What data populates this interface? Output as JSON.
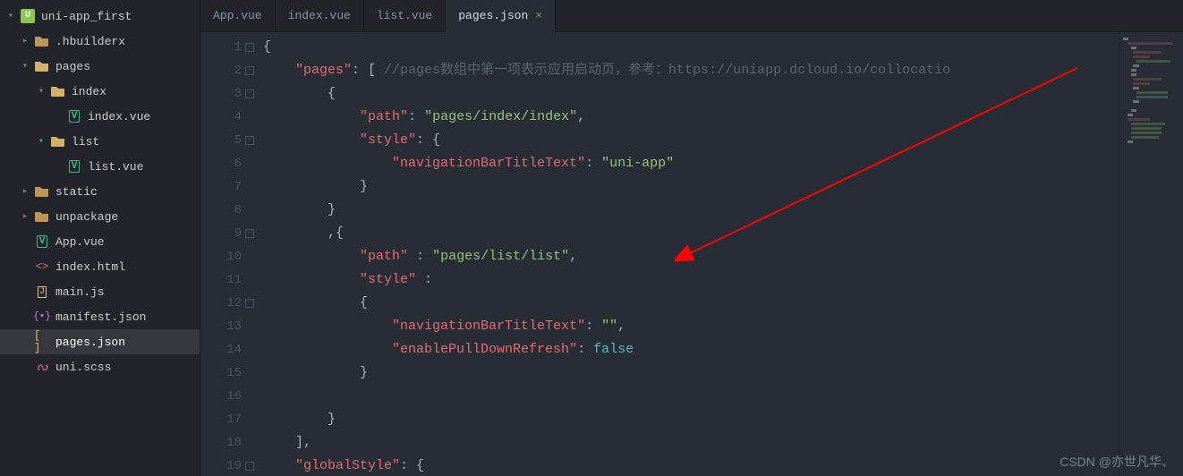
{
  "project": "uni-app_first",
  "tree": [
    {
      "name": ".hbuilderx",
      "type": "folder",
      "state": "closed",
      "indent": 1
    },
    {
      "name": "pages",
      "type": "folder",
      "state": "open",
      "indent": 1
    },
    {
      "name": "index",
      "type": "folder",
      "state": "open",
      "indent": 2
    },
    {
      "name": "index.vue",
      "type": "vue",
      "indent": 3
    },
    {
      "name": "list",
      "type": "folder",
      "state": "open",
      "indent": 2
    },
    {
      "name": "list.vue",
      "type": "vue",
      "indent": 3
    },
    {
      "name": "static",
      "type": "folder",
      "state": "closed",
      "indent": 1
    },
    {
      "name": "unpackage",
      "type": "folder",
      "state": "closed",
      "indent": 1
    },
    {
      "name": "App.vue",
      "type": "vue",
      "indent": 1
    },
    {
      "name": "index.html",
      "type": "html",
      "indent": 1
    },
    {
      "name": "main.js",
      "type": "js",
      "indent": 1
    },
    {
      "name": "manifest.json",
      "type": "json-m",
      "indent": 1
    },
    {
      "name": "pages.json",
      "type": "json-b",
      "indent": 1,
      "selected": true
    },
    {
      "name": "uni.scss",
      "type": "scss",
      "indent": 1
    }
  ],
  "tabs": [
    {
      "label": "App.vue",
      "active": false
    },
    {
      "label": "index.vue",
      "active": false
    },
    {
      "label": "list.vue",
      "active": false
    },
    {
      "label": "pages.json",
      "active": true
    }
  ],
  "code": {
    "lines": [
      {
        "n": 1,
        "fold": true,
        "raw": "{",
        "segs": [
          [
            "{",
            "punct"
          ]
        ]
      },
      {
        "n": 2,
        "fold": true,
        "segs": [
          [
            "    ",
            "p"
          ],
          [
            "\"pages\"",
            "key"
          ],
          [
            ": [ ",
            "punct"
          ],
          [
            "//pages数组中第一项表示应用启动页，参考：https://uniapp.dcloud.io/collocatio",
            "comment"
          ]
        ]
      },
      {
        "n": 3,
        "fold": true,
        "segs": [
          [
            "        {",
            "punct"
          ]
        ]
      },
      {
        "n": 4,
        "segs": [
          [
            "            ",
            "p"
          ],
          [
            "\"path\"",
            "key"
          ],
          [
            ": ",
            "punct"
          ],
          [
            "\"pages/index/index\"",
            "string"
          ],
          [
            ",",
            "punct"
          ]
        ]
      },
      {
        "n": 5,
        "fold": true,
        "segs": [
          [
            "            ",
            "p"
          ],
          [
            "\"style\"",
            "key"
          ],
          [
            ": {",
            "punct"
          ]
        ]
      },
      {
        "n": 6,
        "segs": [
          [
            "                ",
            "p"
          ],
          [
            "\"navigationBarTitleText\"",
            "key"
          ],
          [
            ": ",
            "punct"
          ],
          [
            "\"uni-app\"",
            "string"
          ]
        ]
      },
      {
        "n": 7,
        "segs": [
          [
            "            }",
            "punct"
          ]
        ]
      },
      {
        "n": 8,
        "segs": [
          [
            "        }",
            "punct"
          ]
        ]
      },
      {
        "n": 9,
        "fold": true,
        "segs": [
          [
            "        ,{",
            "punct"
          ]
        ]
      },
      {
        "n": 10,
        "segs": [
          [
            "            ",
            "p"
          ],
          [
            "\"path\"",
            "key"
          ],
          [
            " : ",
            "punct"
          ],
          [
            "\"pages/list/list\"",
            "string"
          ],
          [
            ",",
            "punct"
          ]
        ]
      },
      {
        "n": 11,
        "segs": [
          [
            "            ",
            "p"
          ],
          [
            "\"style\"",
            "key"
          ],
          [
            " :",
            "punct"
          ]
        ]
      },
      {
        "n": 12,
        "fold": true,
        "segs": [
          [
            "            {",
            "punct"
          ]
        ]
      },
      {
        "n": 13,
        "segs": [
          [
            "                ",
            "p"
          ],
          [
            "\"navigationBarTitleText\"",
            "key"
          ],
          [
            ": ",
            "punct"
          ],
          [
            "\"\"",
            "string"
          ],
          [
            ",",
            "punct"
          ]
        ]
      },
      {
        "n": 14,
        "segs": [
          [
            "                ",
            "p"
          ],
          [
            "\"enablePullDownRefresh\"",
            "key"
          ],
          [
            ": ",
            "punct"
          ],
          [
            "false",
            "bool"
          ]
        ]
      },
      {
        "n": 15,
        "segs": [
          [
            "            }",
            "punct"
          ]
        ]
      },
      {
        "n": 16,
        "segs": [
          [
            "",
            "p"
          ]
        ]
      },
      {
        "n": 17,
        "segs": [
          [
            "        }",
            "punct"
          ]
        ]
      },
      {
        "n": 18,
        "segs": [
          [
            "    ],",
            "punct"
          ]
        ]
      },
      {
        "n": 19,
        "fold": true,
        "segs": [
          [
            "    ",
            "p"
          ],
          [
            "\"globalStyle\"",
            "key"
          ],
          [
            ": {",
            "punct"
          ]
        ]
      }
    ]
  },
  "watermark": "CSDN @亦世凡华、",
  "icons": {
    "vue": "V",
    "html": "<>",
    "js": "JS",
    "json_m": "{.}",
    "json_b": "[ ]",
    "scss": "ᔓ",
    "project": "U"
  }
}
